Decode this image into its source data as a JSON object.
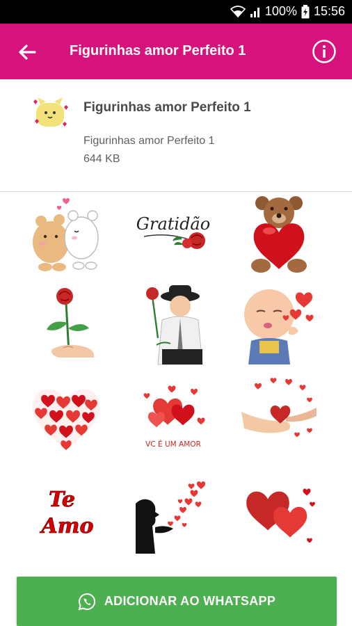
{
  "status_bar": {
    "battery": "100%",
    "time": "15:56"
  },
  "app_bar": {
    "title": "Figurinhas amor Perfeito 1",
    "back_icon": "arrow-back-icon",
    "info_icon": "info-icon"
  },
  "pack": {
    "name": "Figurinhas amor Perfeito 1",
    "publisher": "Figurinhas amor Perfeito 1",
    "size": "644 KB"
  },
  "stickers": [
    {
      "name": "bears-kiss-sticker"
    },
    {
      "name": "gratidao-sticker",
      "text": "Gratidão"
    },
    {
      "name": "teddy-bear-heart-sticker"
    },
    {
      "name": "red-rose-hand-sticker"
    },
    {
      "name": "boy-with-rose-sticker"
    },
    {
      "name": "baby-blowing-kiss-sticker"
    },
    {
      "name": "heart-of-hearts-sticker"
    },
    {
      "name": "vc-e-um-amor-sticker",
      "text": "VC É UM AMOR"
    },
    {
      "name": "hands-holding-heart-sticker"
    },
    {
      "name": "te-amo-sticker",
      "text_line1": "Te",
      "text_line2": "Amo"
    },
    {
      "name": "silhouette-blowing-hearts-sticker"
    },
    {
      "name": "two-hearts-sticker"
    }
  ],
  "add_button": {
    "label": "ADICIONAR AO WHATSAPP",
    "icon": "whatsapp-icon"
  },
  "colors": {
    "app_bar": "#d6127c",
    "button": "#4caf50",
    "heart": "#d0101b"
  }
}
